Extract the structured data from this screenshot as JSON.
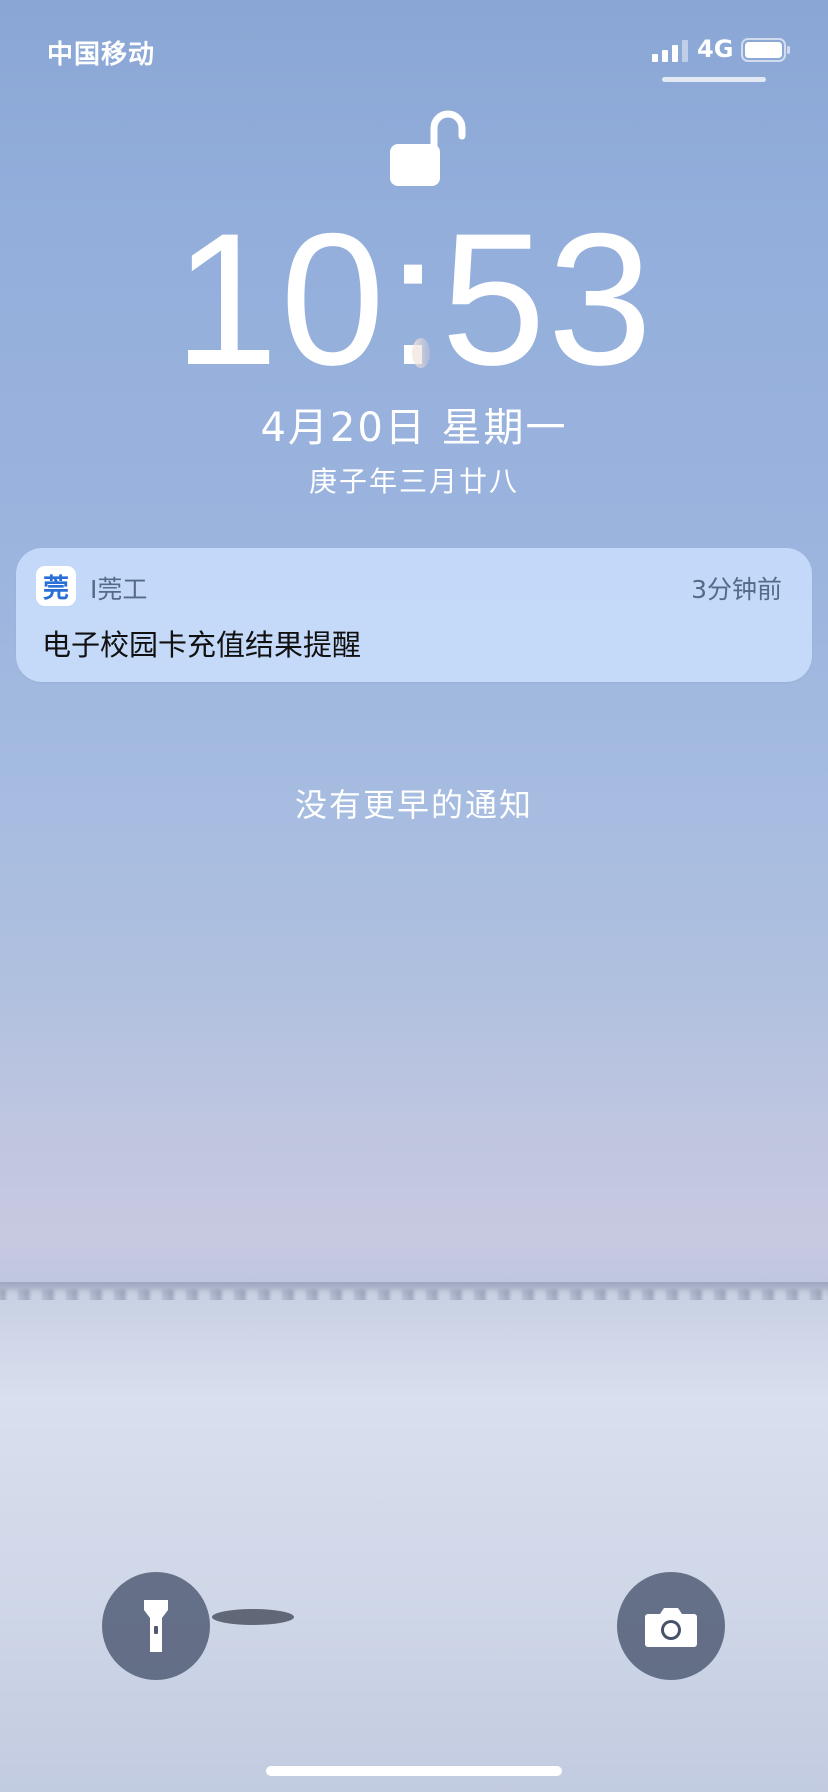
{
  "status_bar": {
    "carrier": "中国移动",
    "network": "4G"
  },
  "lock_screen": {
    "time": "10:53",
    "date": "4月20日 星期一",
    "lunar_date": "庚子年三月廿八"
  },
  "notification": {
    "app_icon_text": "莞",
    "app_name": "I莞工",
    "time_ago": "3分钟前",
    "title": "电子校园卡充值结果提醒"
  },
  "no_earlier_notifications": "没有更早的通知",
  "buttons": {
    "flashlight_icon": "flashlight-icon",
    "camera_icon": "camera-icon"
  },
  "colors": {
    "notification_bg": "#cde1ff",
    "accent": "#2a6fd6"
  }
}
